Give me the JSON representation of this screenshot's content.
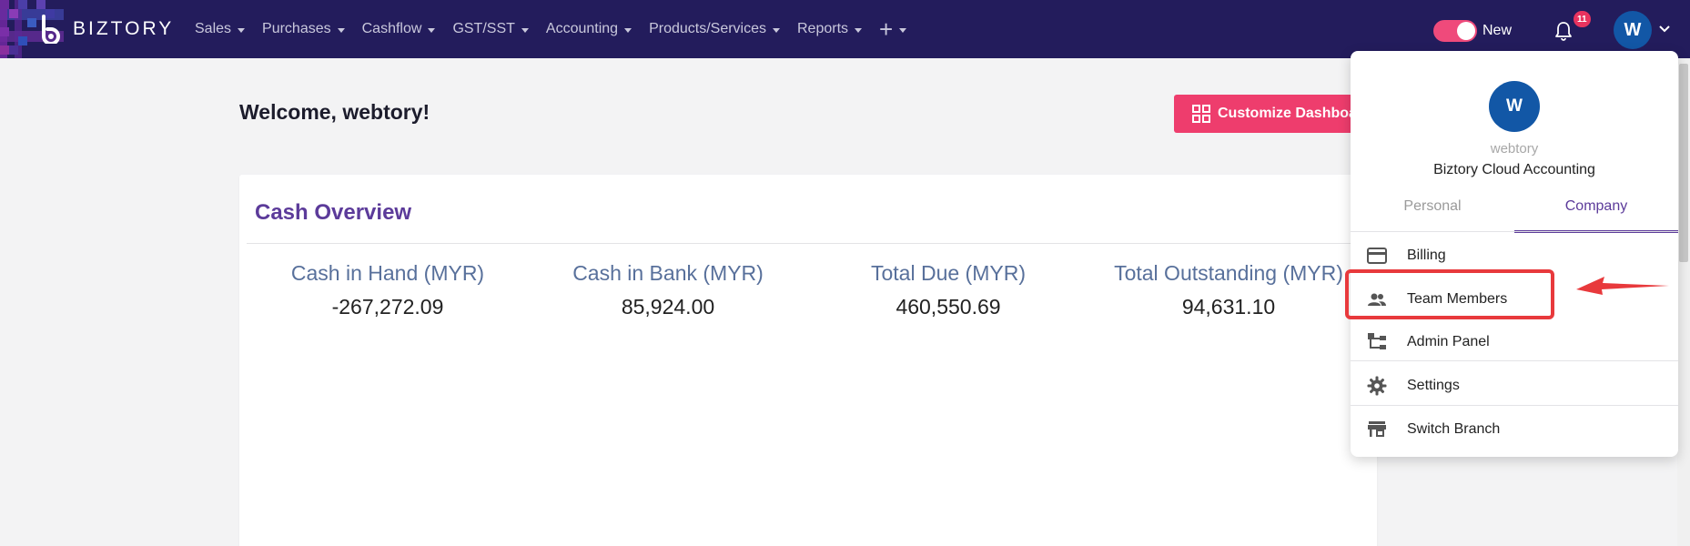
{
  "brand": {
    "name": "BIZTORY"
  },
  "nav": [
    {
      "label": "Sales"
    },
    {
      "label": "Purchases"
    },
    {
      "label": "Cashflow"
    },
    {
      "label": "GST/SST"
    },
    {
      "label": "Accounting"
    },
    {
      "label": "Products/Services"
    },
    {
      "label": "Reports"
    }
  ],
  "header": {
    "toggle_label": "New",
    "toggle_on": true,
    "notification_count": "11",
    "avatar_initial": "W"
  },
  "main": {
    "welcome": "Welcome, webtory!",
    "customize_label": "Customize Dashboard"
  },
  "cash_overview": {
    "title": "Cash Overview",
    "stats": [
      {
        "label": "Cash in Hand (MYR)",
        "value": "-267,272.09"
      },
      {
        "label": "Cash in Bank (MYR)",
        "value": "85,924.00"
      },
      {
        "label": "Total Due (MYR)",
        "value": "460,550.69"
      },
      {
        "label": "Total Outstanding (MYR)",
        "value": "94,631.10"
      }
    ]
  },
  "account_menu": {
    "avatar_initial": "W",
    "username": "webtory",
    "company": "Biztory Cloud Accounting",
    "tabs": [
      {
        "label": "Personal",
        "active": false
      },
      {
        "label": "Company",
        "active": true
      }
    ],
    "items": [
      {
        "label": "Billing",
        "icon": "credit-card-icon"
      },
      {
        "label": "Team Members",
        "icon": "people-icon",
        "highlighted": true
      },
      {
        "label": "Admin Panel",
        "icon": "hierarchy-icon"
      },
      {
        "label": "Settings",
        "icon": "gear-icon"
      },
      {
        "label": "Switch Branch",
        "icon": "store-icon"
      }
    ]
  },
  "colors": {
    "topbar": "#231c5c",
    "accent": "#ee3d6d",
    "purple": "#5c3b9a",
    "avatar": "#1257a6",
    "annotation": "#e8393c"
  }
}
